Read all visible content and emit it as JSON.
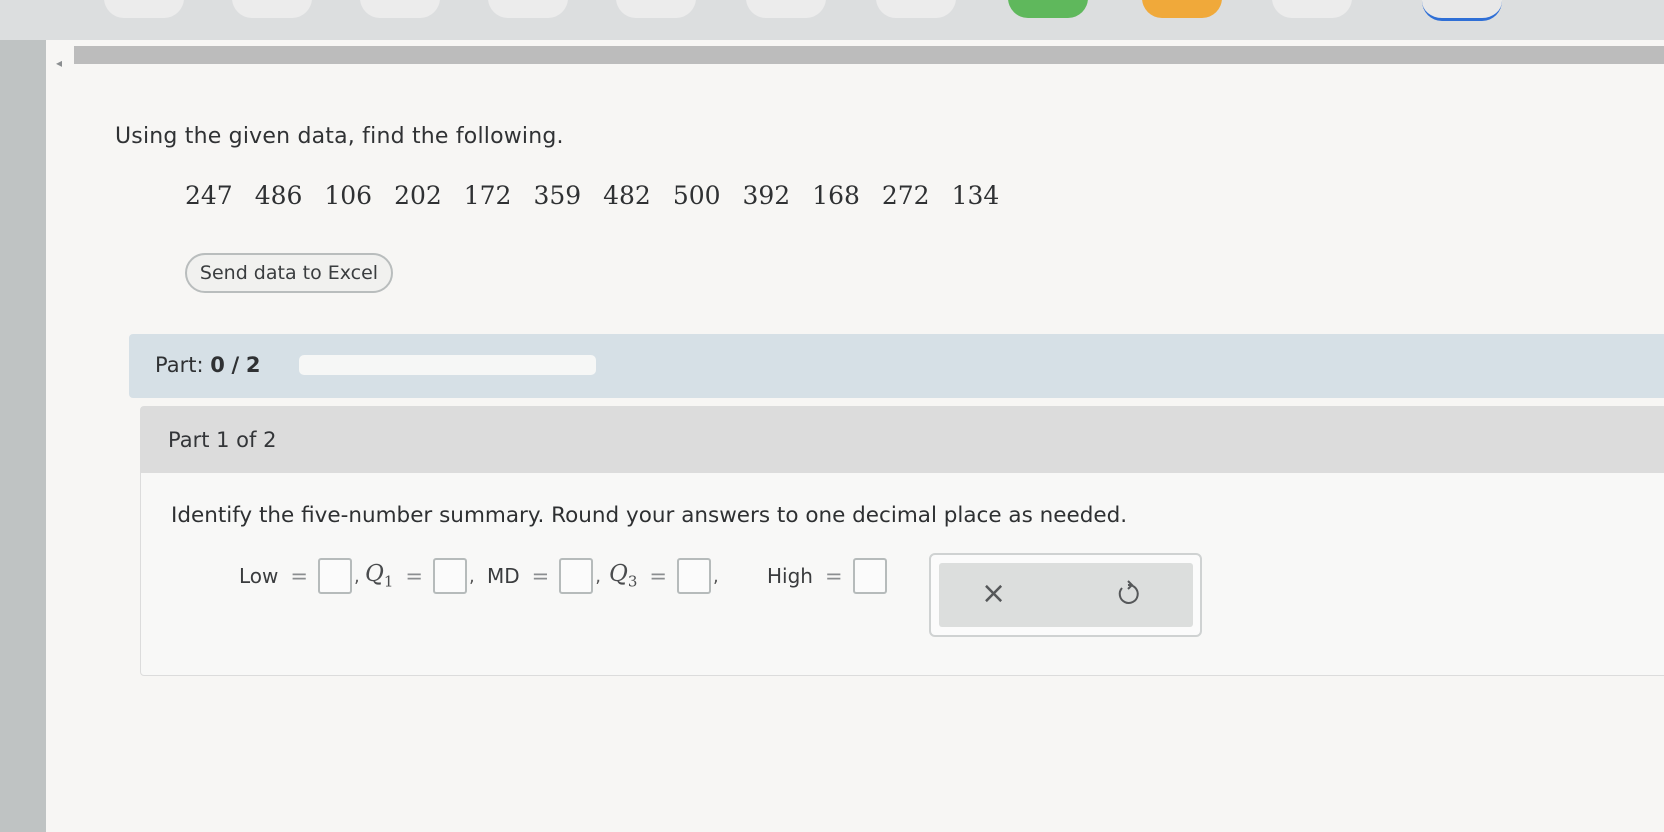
{
  "question": {
    "text": "Using the given data, find the following."
  },
  "data_values": [
    "247",
    "486",
    "106",
    "202",
    "172",
    "359",
    "482",
    "500",
    "392",
    "168",
    "272",
    "134"
  ],
  "excel_button": {
    "label": "Send data to Excel"
  },
  "progress": {
    "prefix": "Part:",
    "current": "0",
    "separator": "/",
    "total": "2",
    "fraction_complete": 0
  },
  "part": {
    "header": "Part 1 of 2",
    "instruction": "Identify the five-number summary. Round your answers to one decimal place as needed."
  },
  "answer_fields": {
    "low_label": "Low",
    "q1_label": "Q",
    "q1_sub": "1",
    "md_label": "MD",
    "q3_label": "Q",
    "q3_sub": "3",
    "high_label": "High",
    "equals": "=",
    "comma": ","
  },
  "actions": {
    "clear_glyph": "×",
    "undo_icon": "undo-icon"
  }
}
